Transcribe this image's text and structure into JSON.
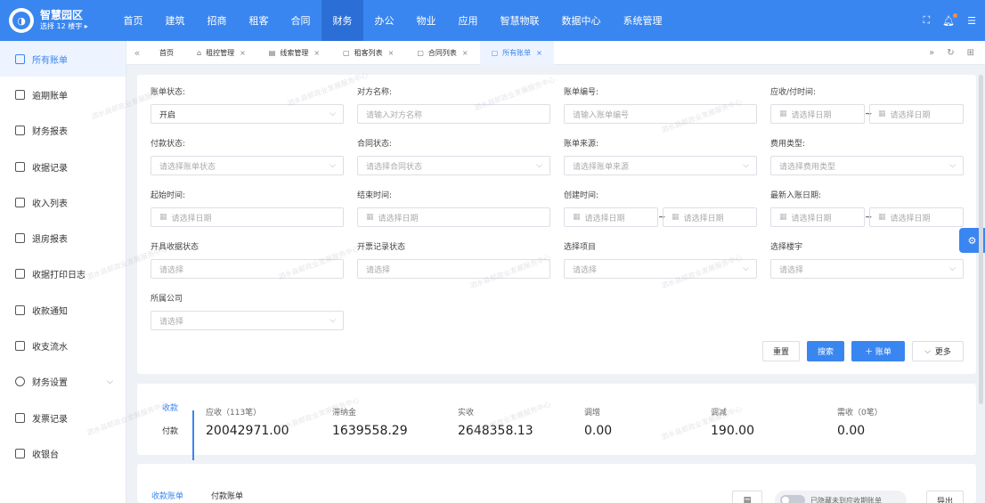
{
  "brand": {
    "title": "智慧园区",
    "subtitle": "选择 12 楼宇 ▸"
  },
  "nav": [
    "首页",
    "建筑",
    "招商",
    "租客",
    "合同",
    "财务",
    "办公",
    "物业",
    "应用",
    "智慧物联",
    "数据中心",
    "系统管理"
  ],
  "sidebar": [
    {
      "label": "所有账单"
    },
    {
      "label": "逾期账单"
    },
    {
      "label": "财务报表"
    },
    {
      "label": "收据记录"
    },
    {
      "label": "收入列表"
    },
    {
      "label": "退房报表"
    },
    {
      "label": "收据打印日志"
    },
    {
      "label": "收款通知"
    },
    {
      "label": "收支流水"
    },
    {
      "label": "财务设置"
    },
    {
      "label": "发票记录"
    },
    {
      "label": "收银台"
    }
  ],
  "tabs": [
    "首页",
    "租控管理",
    "线索管理",
    "租客列表",
    "合同列表",
    "所有账单"
  ],
  "filters": {
    "bill_status": {
      "label": "账单状态:",
      "value": "开启"
    },
    "counterparty": {
      "label": "对方名称:",
      "placeholder": "请输入对方名称"
    },
    "bill_no": {
      "label": "账单编号:",
      "placeholder": "请输入账单编号"
    },
    "due_time": {
      "label": "应收/付时间:",
      "placeholder": "请选择日期"
    },
    "pay_status": {
      "label": "付款状态:",
      "placeholder": "请选择账单状态"
    },
    "contract_status": {
      "label": "合同状态:",
      "placeholder": "请选择合同状态"
    },
    "bill_source": {
      "label": "账单来源:",
      "placeholder": "请选择账单来源"
    },
    "fee_type": {
      "label": "费用类型:",
      "placeholder": "请选择费用类型"
    },
    "start_time": {
      "label": "起始时间:",
      "placeholder": "请选择日期"
    },
    "end_time": {
      "label": "结束时间:",
      "placeholder": "请选择日期"
    },
    "create_time": {
      "label": "创建时间:",
      "placeholder": "请选择日期"
    },
    "latest_entry": {
      "label": "最新入账日期:",
      "placeholder": "请选择日期"
    },
    "receipt_status": {
      "label": "开具收据状态",
      "placeholder": "请选择"
    },
    "invoice_status": {
      "label": "开票记录状态",
      "placeholder": "请选择"
    },
    "project": {
      "label": "选择项目",
      "placeholder": "请选择"
    },
    "building": {
      "label": "选择楼宇",
      "placeholder": "请选择"
    },
    "company": {
      "label": "所属公司",
      "placeholder": "请选择"
    }
  },
  "buttons": {
    "reset": "重置",
    "search": "搜索",
    "add": "＋ 账单",
    "more": "更多"
  },
  "summary": {
    "switch": [
      "收款",
      "付款"
    ],
    "metrics": [
      {
        "label": "应收（113笔）",
        "value": "20042971.00"
      },
      {
        "label": "滞纳金",
        "value": "1639558.29"
      },
      {
        "label": "实收",
        "value": "2648358.13"
      },
      {
        "label": "调增",
        "value": "0.00"
      },
      {
        "label": "调减",
        "value": "190.00"
      },
      {
        "label": "需收（0笔）",
        "value": "0.00"
      }
    ]
  },
  "list": {
    "tabs": [
      "收款账单",
      "付款账单"
    ],
    "toggle": "已隐藏未到应收期账单",
    "export": "导出"
  },
  "watermark": "泗水县邮政业发展服务中心"
}
